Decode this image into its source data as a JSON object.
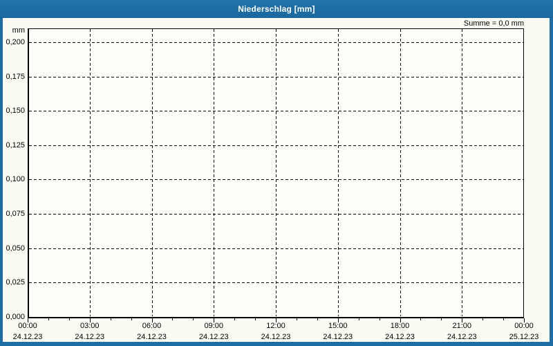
{
  "window": {
    "title": "Niederschlag [mm]"
  },
  "chart_data": {
    "type": "line",
    "title": "Niederschlag [mm]",
    "subtitle": "",
    "xlabel": "",
    "ylabel": "mm",
    "unit_label": "mm",
    "annotation_sum": "Summe = 0,0 mm",
    "ylim": [
      0,
      0.21
    ],
    "grid": "dashed",
    "legend_position": "none",
    "y_ticks": [
      {
        "value": 0.2,
        "label": "0,200"
      },
      {
        "value": 0.175,
        "label": "0,175"
      },
      {
        "value": 0.15,
        "label": "0,150"
      },
      {
        "value": 0.125,
        "label": "0,125"
      },
      {
        "value": 0.1,
        "label": "0,100"
      },
      {
        "value": 0.075,
        "label": "0,075"
      },
      {
        "value": 0.05,
        "label": "0,050"
      },
      {
        "value": 0.025,
        "label": "0,025"
      },
      {
        "value": 0.0,
        "label": "0,000"
      }
    ],
    "x_axis": {
      "range_hours": [
        0,
        24
      ],
      "minor_tick_interval_hours": 1,
      "major_ticks": [
        {
          "hour": 0,
          "time": "00:00",
          "date": "24.12.23"
        },
        {
          "hour": 3,
          "time": "03:00",
          "date": "24.12.23"
        },
        {
          "hour": 6,
          "time": "06:00",
          "date": "24.12.23"
        },
        {
          "hour": 9,
          "time": "09:00",
          "date": "24.12.23"
        },
        {
          "hour": 12,
          "time": "12:00",
          "date": "24.12.23"
        },
        {
          "hour": 15,
          "time": "15:00",
          "date": "24.12.23"
        },
        {
          "hour": 18,
          "time": "18:00",
          "date": "24.12.23"
        },
        {
          "hour": 21,
          "time": "21:00",
          "date": "24.12.23"
        },
        {
          "hour": 24,
          "time": "00:00",
          "date": "25.12.23"
        }
      ]
    },
    "series": [
      {
        "name": "Niederschlag",
        "values": [],
        "note": "no precipitation recorded, sum = 0,0 mm, plot area empty"
      }
    ]
  },
  "colors": {
    "frame_blue": "#1C6EA4",
    "content_bg": "#FBFBF3",
    "plot_bg": "#FEFEFB",
    "grid_black": "#000000",
    "title_text": "#FFFFFF",
    "label_text": "#000000"
  }
}
